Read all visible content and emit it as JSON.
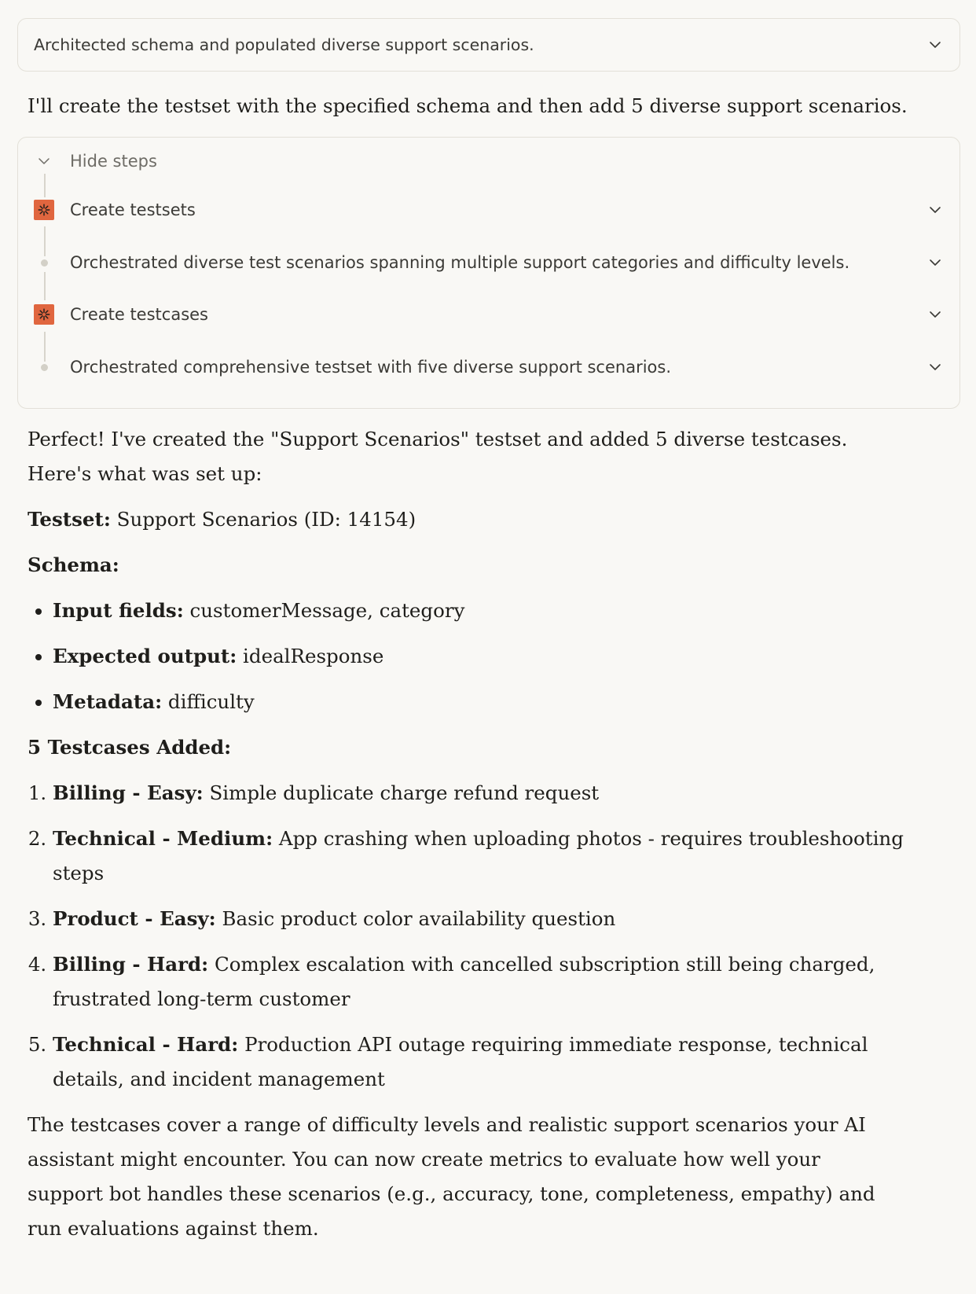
{
  "summary_bar": {
    "text": "Architected schema and populated diverse support scenarios."
  },
  "intro": "I'll create the testset with the specified schema and then add 5 diverse support scenarios.",
  "steps_panel": {
    "toggle_label": "Hide steps",
    "steps": [
      {
        "type": "tool",
        "label": "Create testsets",
        "icon": "tool-asterisk-icon"
      },
      {
        "type": "thought",
        "label": "Orchestrated diverse test scenarios spanning multiple support categories and difficulty levels."
      },
      {
        "type": "tool",
        "label": "Create testcases",
        "icon": "tool-asterisk-icon"
      },
      {
        "type": "thought",
        "label": "Orchestrated comprehensive testset with five diverse support scenarios."
      }
    ]
  },
  "response": {
    "opening": "Perfect! I've created the \"Support Scenarios\" testset and added 5 diverse testcases. Here's what was set up:",
    "testset_label": "Testset:",
    "testset_value": " Support Scenarios (ID: 14154)",
    "schema_heading": "Schema:",
    "schema_items": [
      {
        "label": "Input fields:",
        "value": " customerMessage, category"
      },
      {
        "label": "Expected output:",
        "value": " idealResponse"
      },
      {
        "label": "Metadata:",
        "value": " difficulty"
      }
    ],
    "testcases_heading": "5 Testcases Added:",
    "testcases": [
      {
        "label": "Billing - Easy:",
        "value": " Simple duplicate charge refund request"
      },
      {
        "label": "Technical - Medium:",
        "value": " App crashing when uploading photos - requires troubleshooting steps"
      },
      {
        "label": "Product - Easy:",
        "value": " Basic product color availability question"
      },
      {
        "label": "Billing - Hard:",
        "value": " Complex escalation with cancelled subscription still being charged, frustrated long-term customer"
      },
      {
        "label": "Technical - Hard:",
        "value": " Production API outage requiring immediate response, technical details, and incident management"
      }
    ],
    "closing": "The testcases cover a range of difficulty levels and realistic support scenarios your AI assistant might encounter. You can now create metrics to evaluate how well your support bot handles these scenarios (e.g., accuracy, tone, completeness, empathy) and run evaluations against them."
  },
  "colors": {
    "background": "#f9f8f5",
    "tool_icon": "#e0663f",
    "border": "#e3e0d8"
  }
}
